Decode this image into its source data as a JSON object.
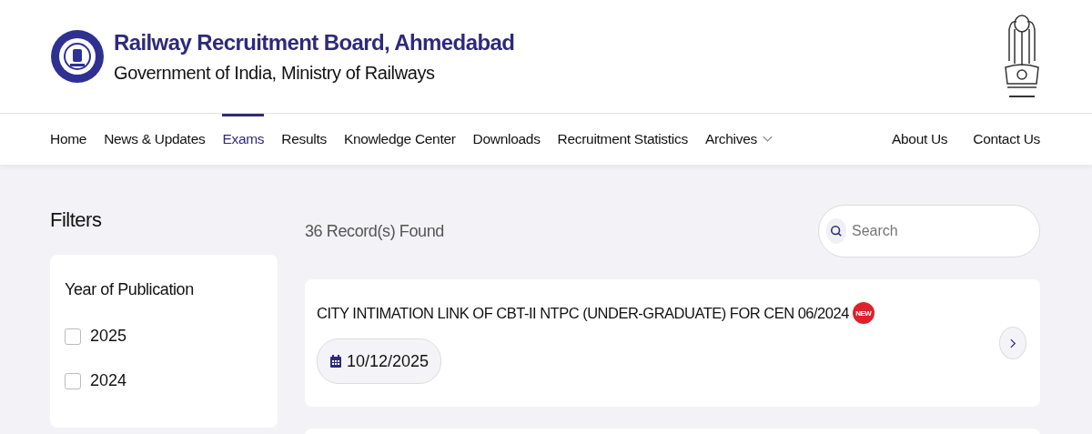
{
  "header": {
    "title": "Railway Recruitment Board, Ahmedabad",
    "subtitle": "Government of India, Ministry of Railways"
  },
  "nav": {
    "left": [
      {
        "label": "Home",
        "selected": false
      },
      {
        "label": "News & Updates",
        "selected": false
      },
      {
        "label": "Exams",
        "selected": true
      },
      {
        "label": "Results",
        "selected": false
      },
      {
        "label": "Knowledge Center",
        "selected": false
      },
      {
        "label": "Downloads",
        "selected": false
      },
      {
        "label": "Recruitment Statistics",
        "selected": false
      },
      {
        "label": "Archives",
        "selected": false,
        "kind": "dropdown"
      }
    ],
    "right": [
      {
        "label": "About Us",
        "selected": false
      },
      {
        "label": "Contact Us",
        "selected": false
      }
    ]
  },
  "filters": {
    "title": "Filters",
    "group": "Year of Publication",
    "options": [
      {
        "label": "2025",
        "checked": false
      },
      {
        "label": "2024",
        "checked": false
      }
    ]
  },
  "results": {
    "count": "36 Record(s) Found",
    "search": {
      "placeholder": "Search"
    },
    "items": [
      {
        "title": "CITY INTIMATION LINK OF CBT-II NTPC (UNDER-GRADUATE) FOR CEN 06/2024",
        "badge": "NEW",
        "date": "10/12/2025"
      }
    ]
  }
}
